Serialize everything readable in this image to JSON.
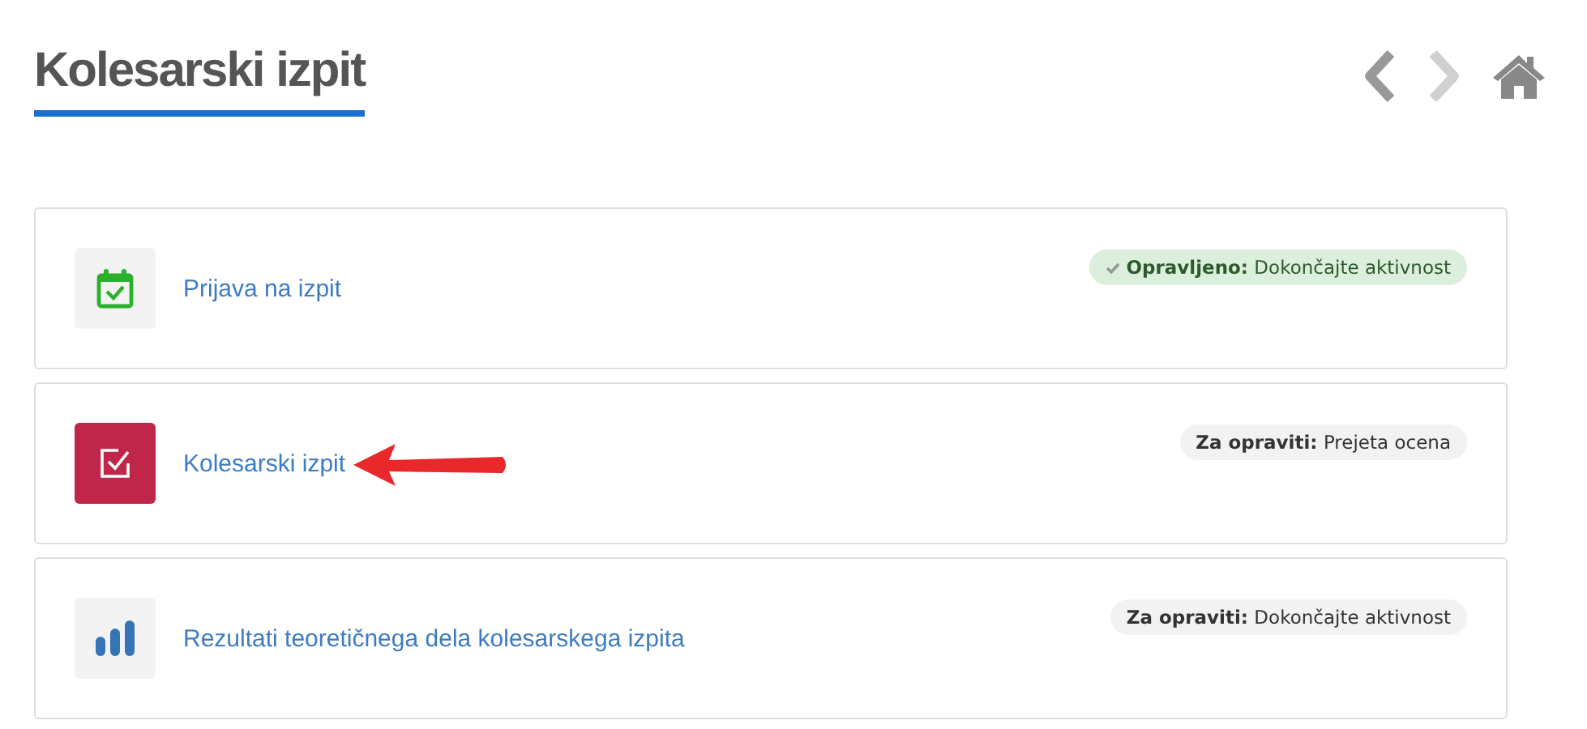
{
  "page": {
    "title": "Kolesarski izpit"
  },
  "nav": {
    "prev_disabled": false,
    "next_disabled": true
  },
  "activities": [
    {
      "kind": "calendar",
      "title": "Prijava na izpit",
      "status": {
        "done": true,
        "text": "**Opravljeno:** Dokončajte aktivnost"
      },
      "pointed": false
    },
    {
      "kind": "quiz",
      "title": "Kolesarski izpit",
      "status": {
        "done": false,
        "text": "**Za opraviti:** Prejeta ocena"
      },
      "pointed": true
    },
    {
      "kind": "chart",
      "title": "Rezultati teoretičnega dela kolesarskega izpita",
      "status": {
        "done": false,
        "text": "**Za opraviti:** Dokončajte aktivnost"
      },
      "pointed": false
    }
  ]
}
